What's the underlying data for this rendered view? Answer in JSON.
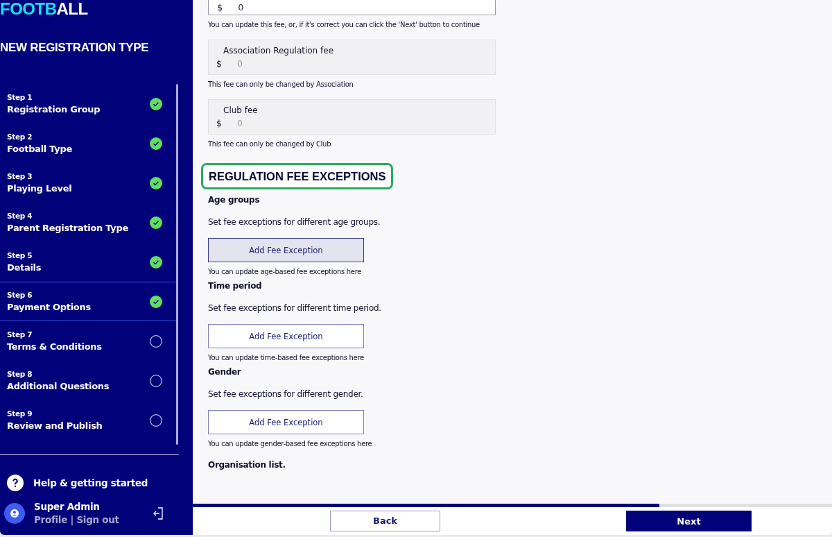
{
  "sidebar": {
    "logo": {
      "accent": "FOOTB",
      "rest": "ALL"
    },
    "title": "NEW REGISTRATION TYPE",
    "steps": [
      {
        "step": "Step 1",
        "label": "Registration Group",
        "done": true,
        "selected": false
      },
      {
        "step": "Step 2",
        "label": "Football Type",
        "done": true,
        "selected": false
      },
      {
        "step": "Step 3",
        "label": "Playing Level",
        "done": true,
        "selected": false
      },
      {
        "step": "Step 4",
        "label": "Parent Registration Type",
        "done": true,
        "selected": false
      },
      {
        "step": "Step 5",
        "label": "Details",
        "done": true,
        "selected": false
      },
      {
        "step": "Step 6",
        "label": "Payment Options",
        "done": true,
        "selected": true
      },
      {
        "step": "Step 7",
        "label": "Terms & Conditions",
        "done": false,
        "selected": false
      },
      {
        "step": "Step 8",
        "label": "Additional Questions",
        "done": false,
        "selected": false
      },
      {
        "step": "Step 9",
        "label": "Review and Publish",
        "done": false,
        "selected": false
      }
    ],
    "help": "Help & getting started",
    "user": {
      "name": "Super Admin",
      "links": "Profile | Sign out"
    }
  },
  "main": {
    "top_field": {
      "currency": "$",
      "value": "0"
    },
    "top_hint": "You can update this fee, or, if it's correct you can click the 'Next' button to continue",
    "fees": [
      {
        "label": "Association Regulation fee",
        "currency": "$",
        "value": "0",
        "hint": "This fee can only be changed by Association"
      },
      {
        "label": "Club fee",
        "currency": "$",
        "value": "0",
        "hint": "This fee can only be changed by Club"
      }
    ],
    "section_title": "REGULATION FEE EXCEPTIONS",
    "section_highlighted": true,
    "exceptions": [
      {
        "title": "Age groups",
        "description": "Set fee exceptions for different age groups.",
        "button": "Add Fee Exception",
        "hovered": true,
        "hint": "You can update age-based fee exceptions here"
      },
      {
        "title": "Time period",
        "description": "Set fee exceptions for different time period.",
        "button": "Add Fee Exception",
        "hovered": false,
        "hint": "You can update time-based fee exceptions here"
      },
      {
        "title": "Gender",
        "description": "Set fee exceptions for different gender.",
        "button": "Add Fee Exception",
        "hovered": false,
        "hint": "You can update gender-based fee exceptions here"
      }
    ],
    "org_title": "Organisation list."
  },
  "footer": {
    "progress": {
      "level": 0.73
    },
    "back": "Back",
    "next": "Next"
  }
}
